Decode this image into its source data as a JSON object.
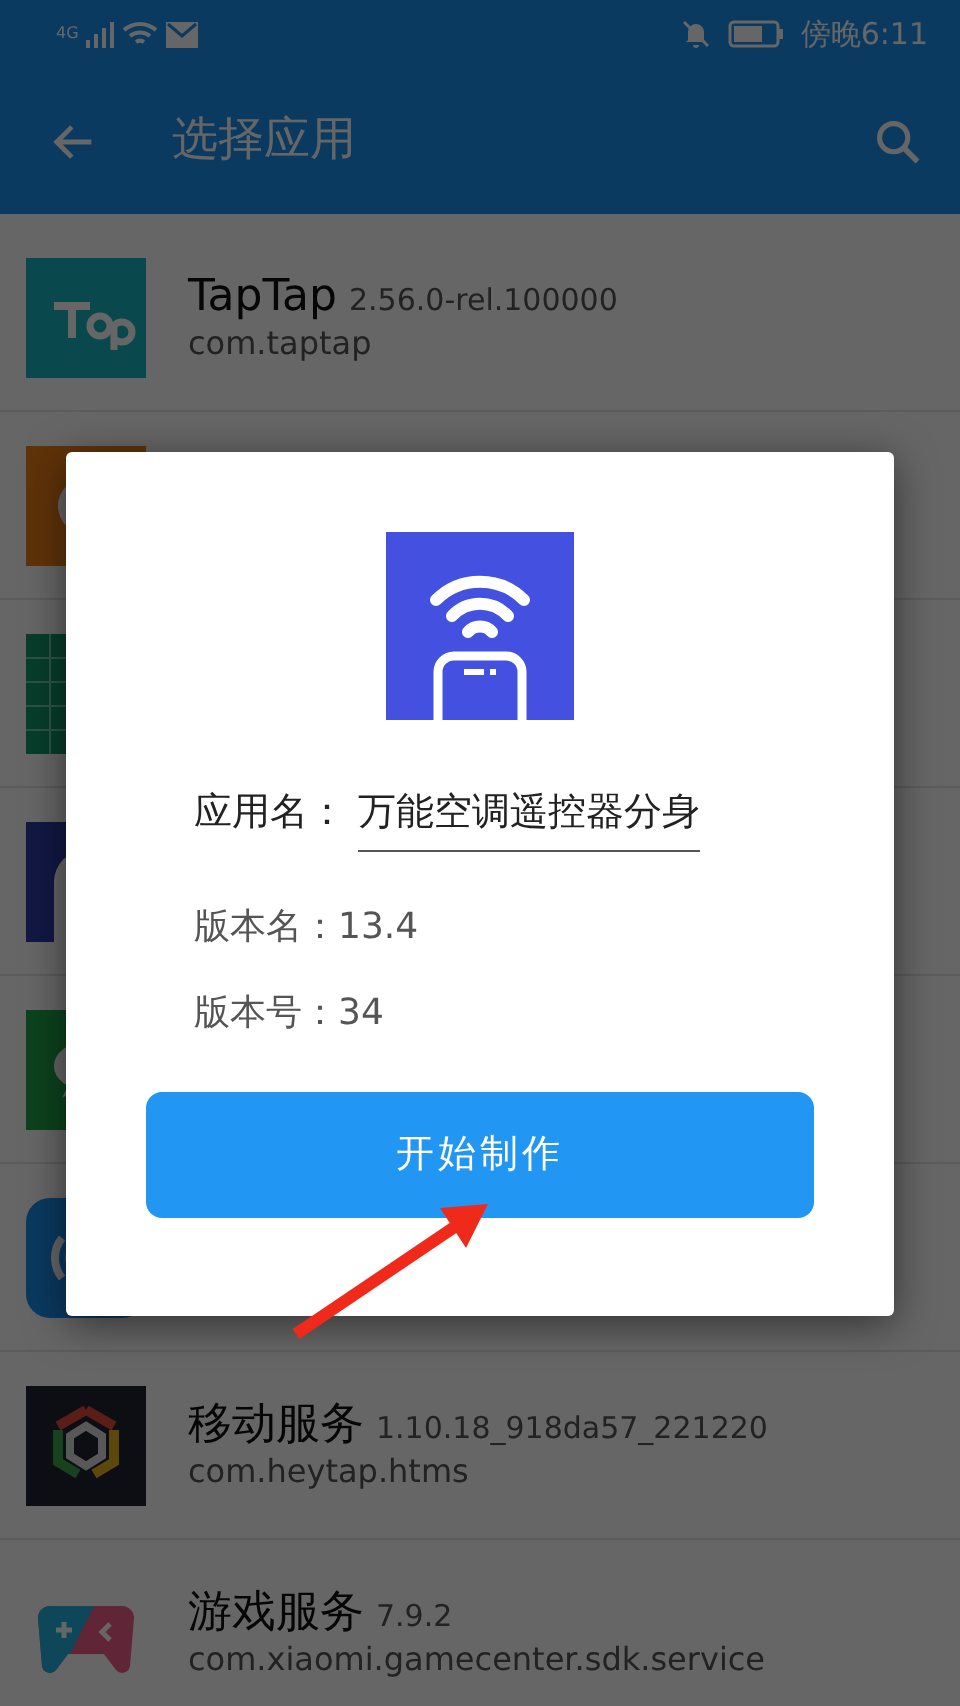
{
  "status_bar": {
    "network": "4G",
    "time": "傍晚6:11"
  },
  "toolbar": {
    "title": "选择应用"
  },
  "apps": [
    {
      "kind": "listing",
      "name": "TapTap",
      "version": "2.56.0-rel.100000",
      "package": "com.taptap"
    },
    {
      "kind": "covered"
    },
    {
      "kind": "covered"
    },
    {
      "kind": "covered"
    },
    {
      "kind": "covered"
    },
    {
      "kind": "covered"
    },
    {
      "kind": "listing",
      "name": "移动服务",
      "version": "1.10.18_918da57_221220",
      "package": "com.heytap.htms"
    },
    {
      "kind": "listing",
      "name": "游戏服务",
      "version": "7.9.2",
      "package": "com.xiaomi.gamecenter.sdk.service"
    }
  ],
  "dialog": {
    "app_name_label": "应用名：",
    "app_name": "万能空调遥控器分身",
    "version_name_label": "版本名：",
    "version_name": "13.4",
    "version_code_label": "版本号：",
    "version_code": "34",
    "button": "开始制作"
  }
}
